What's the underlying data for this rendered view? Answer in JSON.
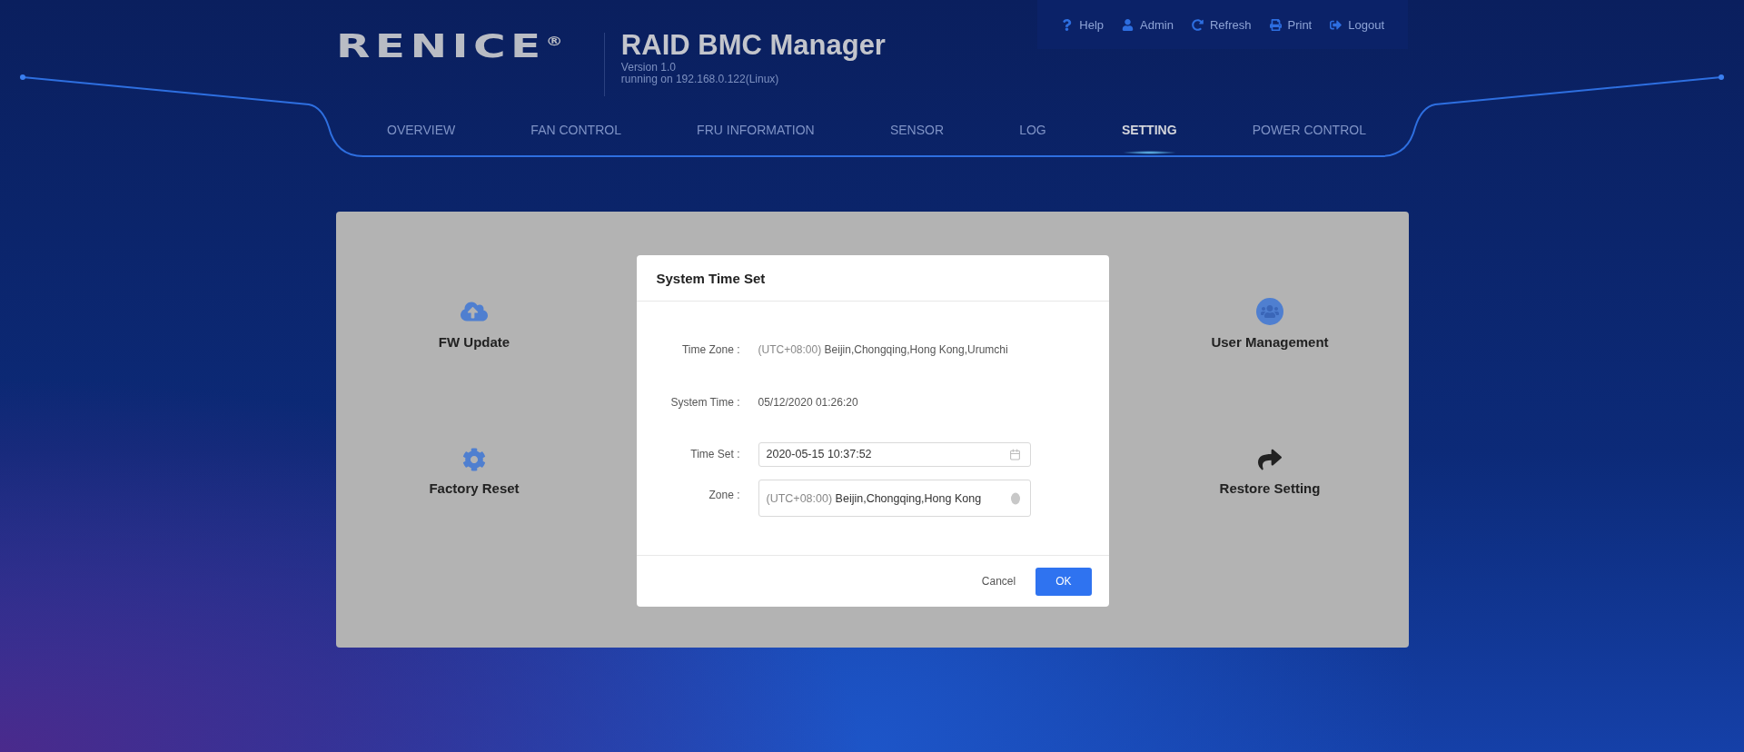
{
  "header": {
    "logo": "RENICE",
    "logo_mark": "®",
    "title": "RAID BMC Manager",
    "version": "Version 1.0",
    "running": "running on 192.168.0.122(Linux)"
  },
  "top_links": [
    {
      "kind": "help",
      "label": "Help"
    },
    {
      "kind": "user",
      "label": "Admin"
    },
    {
      "kind": "refresh",
      "label": "Refresh"
    },
    {
      "kind": "print",
      "label": "Print"
    },
    {
      "kind": "logout",
      "label": "Logout"
    }
  ],
  "nav": [
    {
      "label": "OVERVIEW",
      "selected": false
    },
    {
      "label": "FAN CONTROL",
      "selected": false
    },
    {
      "label": "FRU INFORMATION",
      "selected": false
    },
    {
      "label": "SENSOR",
      "selected": false
    },
    {
      "label": "LOG",
      "selected": false
    },
    {
      "label": "SETTING",
      "selected": true
    },
    {
      "label": "POWER CONTROL",
      "selected": false
    }
  ],
  "settings": {
    "left": [
      {
        "kind": "upload",
        "label": "FW Update"
      },
      {
        "kind": "gear",
        "label": "Factory Reset"
      }
    ],
    "right": [
      {
        "kind": "users",
        "label": "User Management"
      },
      {
        "kind": "share",
        "label": "Restore Setting"
      }
    ]
  },
  "dialog": {
    "title": "System Time Set",
    "fields": [
      {
        "kind": "text",
        "label": "Time Zone :",
        "value_prefix": "(UTC+08:00)",
        "value": "Beijin,Chongqing,Hong Kong,Urumchi"
      },
      {
        "kind": "text",
        "label": "System Time :",
        "value": "05/12/2020 01:26:20"
      },
      {
        "kind": "date",
        "label": "Time Set :",
        "value": "2020-05-15 10:37:52"
      },
      {
        "kind": "select",
        "label": "Zone :",
        "value_prefix": "(UTC+08:00)",
        "value": "Beijin,Chongqing,Hong Kong"
      }
    ],
    "buttons": [
      {
        "label": "Cancel",
        "primary": false
      },
      {
        "label": "OK",
        "primary": true
      }
    ]
  }
}
